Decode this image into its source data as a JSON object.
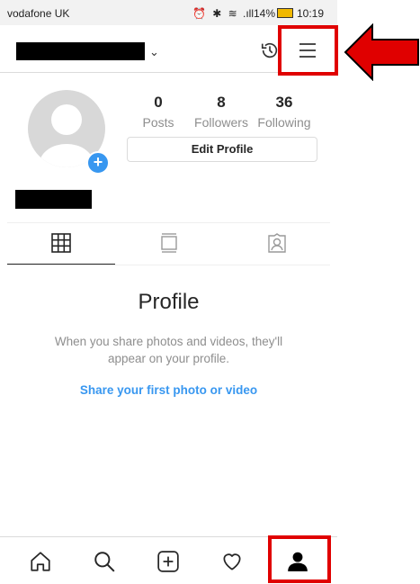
{
  "status_bar": {
    "carrier": "vodafone UK",
    "icons": "⏰ ✱ ≋",
    "battery": ".ıll14%",
    "time": "10:19"
  },
  "header": {
    "username_redacted": true
  },
  "profile": {
    "stats": [
      {
        "value": "0",
        "label": "Posts"
      },
      {
        "value": "8",
        "label": "Followers"
      },
      {
        "value": "36",
        "label": "Following"
      }
    ],
    "edit_button": "Edit Profile"
  },
  "empty_state": {
    "title": "Profile",
    "description": "When you share photos and videos, they'll appear on your profile.",
    "link": "Share your first photo or video"
  },
  "colors": {
    "accent": "#3897f0",
    "highlight": "#e00000"
  },
  "icons": {
    "tabs": [
      "grid-icon",
      "feed-icon",
      "tagged-icon"
    ],
    "bottom_nav": [
      "home-icon",
      "search-icon",
      "add-icon",
      "heart-icon",
      "profile-icon"
    ]
  }
}
